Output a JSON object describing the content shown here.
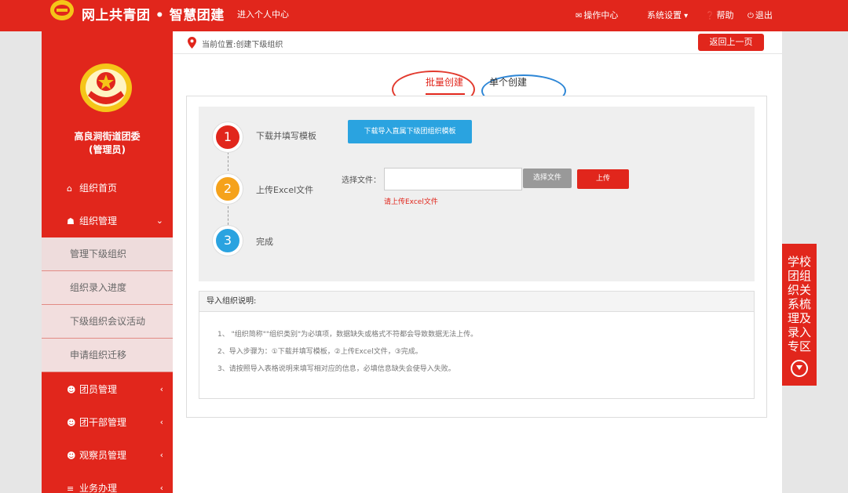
{
  "header": {
    "brand": "网上共青团 • 智慧团建",
    "personal_link": "进入个人中心",
    "nav": {
      "ops_center": "操作中心",
      "settings": "系统设置",
      "help": "帮助",
      "logout": "退出"
    }
  },
  "sidebar": {
    "org_name_line1": "高良涧街道团委",
    "org_name_line2": "(管理员)",
    "items": [
      {
        "label": "组织首页",
        "icon": "home-icon"
      },
      {
        "label": "组织管理",
        "icon": "sitemap-icon"
      },
      {
        "label": "团员管理",
        "icon": "users-icon"
      },
      {
        "label": "团干部管理",
        "icon": "users-icon"
      },
      {
        "label": "观察员管理",
        "icon": "users-icon"
      },
      {
        "label": "业务办理",
        "icon": "list-icon"
      }
    ],
    "sub_items": [
      {
        "label": "管理下级组织"
      },
      {
        "label": "组织录入进度"
      },
      {
        "label": "下级组织会议活动"
      },
      {
        "label": "申请组织迁移"
      }
    ]
  },
  "breadcrumb": "当前位置:创建下级组织",
  "back_button": "返回上一页",
  "tabs": {
    "batch": "批量创建",
    "single": "单个创建"
  },
  "steps": [
    {
      "number": "1",
      "label": "下载并填写模板",
      "color": "#e1261c"
    },
    {
      "number": "2",
      "label": "上传Excel文件",
      "color": "#f5a21b"
    },
    {
      "number": "3",
      "label": "完成",
      "color": "#2aa3e0"
    }
  ],
  "download_button": "下载导入直属下级团组织模板",
  "file_label": "选择文件：",
  "file_value": "",
  "choose_button": "选择文件",
  "upload_button": "上传",
  "upload_hint": "请上传Excel文件",
  "notes": {
    "title": "导入组织说明:",
    "lines": [
      "1、 \"组织简称\"\"组织类别\"为必填项，数据缺失或格式不符都会导致数据无法上传。",
      "2、导入步骤为：①下载并填写模板，②上传Excel文件，③完成。",
      "3、请按照导入表格说明来填写相对应的信息，必填信息缺失会使导入失败。"
    ]
  },
  "side_tab": "学校团组织关系梳理及录入专区",
  "colors": {
    "primary": "#e1261c",
    "blue": "#2aa3e0",
    "orange": "#f5a21b"
  }
}
